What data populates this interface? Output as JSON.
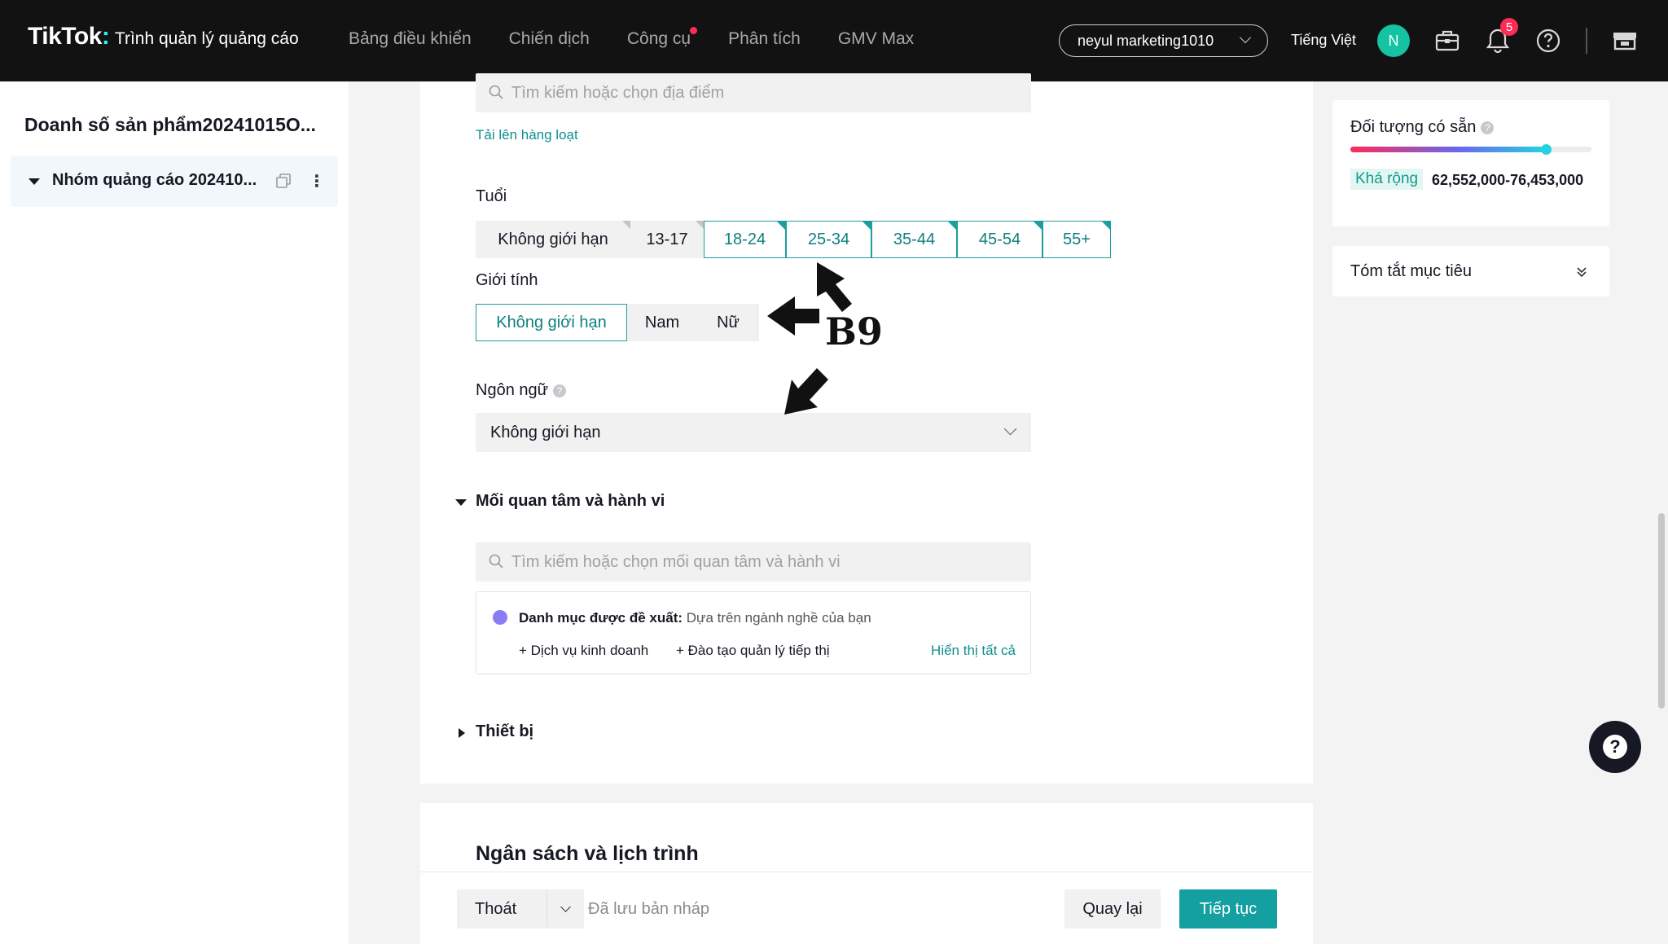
{
  "header": {
    "brand": "TikTok",
    "brand_sep": ":",
    "subtitle": "Trình quản lý quảng cáo",
    "nav": [
      "Bảng điều khiển",
      "Chiến dịch",
      "Công cụ",
      "Phân tích",
      "GMV Max"
    ],
    "account": "neyul marketing1010",
    "language": "Tiếng Việt",
    "avatar_initial": "N",
    "notifications": "5"
  },
  "sidebar": {
    "campaign_title": "Doanh số sản phẩm20241015O...",
    "ad_group": "Nhóm quảng cáo 202410..."
  },
  "targeting": {
    "location_search_placeholder": "Tìm kiếm hoặc chọn địa điểm",
    "bulk_upload": "Tải lên hàng loạt",
    "age_label": "Tuổi",
    "age_options": [
      "Không giới hạn",
      "13-17",
      "18-24",
      "25-34",
      "35-44",
      "45-54",
      "55+"
    ],
    "gender_label": "Giới tính",
    "gender_options": [
      "Không giới hạn",
      "Nam",
      "Nữ"
    ],
    "language_label": "Ngôn ngữ",
    "language_value": "Không giới hạn",
    "interests_label": "Mối quan tâm và hành vi",
    "interests_search_placeholder": "Tìm kiếm hoặc chọn mối quan tâm và hành vi",
    "suggested_title": "Danh mục được đề xuất:",
    "suggested_desc": "Dựa trên ngành nghề của bạn",
    "suggested_items": [
      "+ Dịch vụ kinh doanh",
      "+ Đào tạo quản lý tiếp thị"
    ],
    "show_all": "Hiển thị tất cả",
    "devices_label": "Thiết bị"
  },
  "budget": {
    "title": "Ngân sách và lịch trình"
  },
  "footer": {
    "exit": "Thoát",
    "draft_saved": "Đã lưu bản nháp",
    "back": "Quay lại",
    "next": "Tiếp tục"
  },
  "audience": {
    "title": "Đối tượng có sẵn",
    "breadth_tag": "Khá rộng",
    "range": "62,552,000-76,453,000",
    "gauge_level": 0.81
  },
  "summary": {
    "title": "Tóm tắt mục tiêu"
  },
  "annotation": {
    "label": "B9"
  },
  "colors": {
    "accent": "#14a0a0",
    "topbar": "#121212",
    "badge": "#fe2c55"
  }
}
